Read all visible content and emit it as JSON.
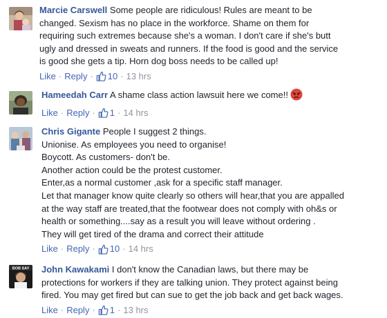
{
  "comments": [
    {
      "author": "Marcie Carswell",
      "lines": [
        "Some people are ridiculous! Rules are meant to be",
        "changed. Sexism has no place in the workforce. Shame on them for",
        "requiring such extremes because she's a woman. I don't care if she's butt",
        "ugly and dressed in sweats and runners. If the food is good and the service",
        "is good she gets a tip. Horn dog boss needs to be called up!"
      ],
      "like_label": "Like",
      "reply_label": "Reply",
      "like_count": "10",
      "time": "13 hrs",
      "avatar": "woman-with-child-photo"
    },
    {
      "author": "Hameedah Carr",
      "lines": [
        "A shame class action lawsuit here we come!!"
      ],
      "emoji": "angry-face-emoji",
      "like_label": "Like",
      "reply_label": "Reply",
      "like_count": "1",
      "time": "14 hrs",
      "avatar": "woman-portrait-photo"
    },
    {
      "author": "Chris Gigante",
      "lines": [
        "People I suggest 2 things.",
        "Unionise. As employees you need to organise!",
        "Boycott. As customers- don't be.",
        "Another action could be the protest customer.",
        "Enter,as a normal customer ,ask for a specific staff manager.",
        "Let that manager know quite clearly so others will hear,that you are appalled",
        "at the way staff are treated,that the footwear does not comply with oh&s or",
        "health or something....say as a result you will leave without ordering .",
        "They will get tired of the drama and correct their attitude"
      ],
      "like_label": "Like",
      "reply_label": "Reply",
      "like_count": "10",
      "time": "14 hrs",
      "avatar": "group-photo"
    },
    {
      "author": "John Kawakami",
      "lines": [
        "I don't know the Canadian laws, but there may be",
        "protections for workers if they are talking union. They protect against being",
        "fired. You may get fired but can sue to get the job back and get back wages."
      ],
      "like_label": "Like",
      "reply_label": "Reply",
      "like_count": "1",
      "time": "13 hrs",
      "avatar": "bob-say-poster",
      "avatar_text": "BOB SAY"
    }
  ],
  "colors": {
    "author": "#365899",
    "link": "#4267b2",
    "meta": "#90949c",
    "text": "#1d2129"
  }
}
